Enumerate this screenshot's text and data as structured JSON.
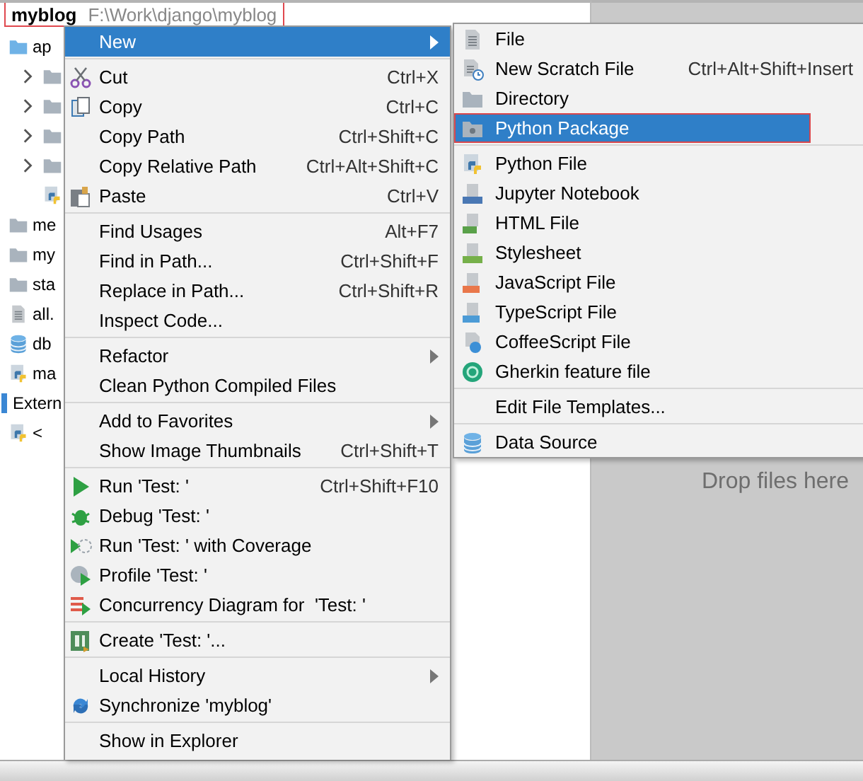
{
  "project_tree": {
    "root": {
      "label": "myblog",
      "path": "F:\\Work\\django\\myblog",
      "annotated": true
    },
    "items": [
      {
        "label": "ap",
        "kind": "folder",
        "children": [
          {
            "kind": "folder",
            "expanded": false
          },
          {
            "kind": "folder",
            "expanded": false
          },
          {
            "kind": "folder",
            "expanded": false
          },
          {
            "kind": "folder",
            "expanded": false
          },
          {
            "kind": "python"
          }
        ]
      },
      {
        "label": "me",
        "kind": "folder"
      },
      {
        "label": "my",
        "kind": "folder"
      },
      {
        "label": "sta",
        "kind": "folder"
      },
      {
        "label": "all.",
        "kind": "text"
      },
      {
        "label": "db",
        "kind": "database"
      },
      {
        "label": "ma",
        "kind": "python"
      }
    ],
    "external": {
      "label": "Extern",
      "children": [
        {
          "label": "<",
          "kind": "python"
        }
      ]
    }
  },
  "context_menu": {
    "groups": [
      [
        {
          "label": "New",
          "selected": true,
          "submenu": true
        }
      ],
      [
        {
          "label": "Cut",
          "shortcut": "Ctrl+X",
          "kind": "scissors",
          "selected": false
        },
        {
          "label": "Copy",
          "shortcut": "Ctrl+C",
          "kind": "copy",
          "selected": false
        },
        {
          "label": "Copy Path",
          "shortcut": "Ctrl+Shift+C",
          "selected": false
        },
        {
          "label": "Copy Relative Path",
          "shortcut": "Ctrl+Alt+Shift+C",
          "selected": false
        },
        {
          "label": "Paste",
          "shortcut": "Ctrl+V",
          "kind": "paste",
          "selected": false
        }
      ],
      [
        {
          "label": "Find Usages",
          "shortcut": "Alt+F7",
          "selected": false
        },
        {
          "label": "Find in Path...",
          "shortcut": "Ctrl+Shift+F",
          "selected": false
        },
        {
          "label": "Replace in Path...",
          "shortcut": "Ctrl+Shift+R",
          "selected": false
        },
        {
          "label": "Inspect Code...",
          "selected": false
        }
      ],
      [
        {
          "label": "Refactor",
          "submenu": true,
          "selected": false
        },
        {
          "label": "Clean Python Compiled Files",
          "selected": false
        }
      ],
      [
        {
          "label": "Add to Favorites",
          "submenu": true,
          "selected": false
        },
        {
          "label": "Show Image Thumbnails",
          "shortcut": "Ctrl+Shift+T",
          "selected": false
        }
      ],
      [
        {
          "label": "Run 'Test: '",
          "shortcut": "Ctrl+Shift+F10",
          "kind": "run",
          "selected": false
        },
        {
          "label": "Debug 'Test: '",
          "kind": "debug",
          "selected": false
        },
        {
          "label": "Run 'Test: ' with Coverage",
          "kind": "coverage",
          "selected": false
        },
        {
          "label": "Profile 'Test: '",
          "kind": "profile",
          "selected": false
        },
        {
          "label": "Concurrency Diagram for  'Test: '",
          "kind": "concurrency",
          "selected": false
        }
      ],
      [
        {
          "label": "Create 'Test: '...",
          "kind": "create",
          "selected": false
        }
      ],
      [
        {
          "label": "Local History",
          "submenu": true,
          "selected": false
        },
        {
          "label": "Synchronize 'myblog'",
          "kind": "sync",
          "selected": false
        }
      ],
      [
        {
          "label": "Show in Explorer",
          "selected": false
        }
      ]
    ]
  },
  "new_submenu": {
    "groups": [
      [
        {
          "label": "File",
          "kind": "file",
          "selected": false
        },
        {
          "label": "New Scratch File",
          "shortcut": "Ctrl+Alt+Shift+Insert",
          "kind": "scratch",
          "selected": false
        },
        {
          "label": "Directory",
          "kind": "folder",
          "selected": false
        },
        {
          "label": "Python Package",
          "kind": "package",
          "selected": true,
          "annotated": true
        }
      ],
      [
        {
          "label": "Python File",
          "kind": "python",
          "selected": false
        },
        {
          "label": "Jupyter Notebook",
          "kind": "jupyter",
          "selected": false
        },
        {
          "label": "HTML File",
          "kind": "html",
          "selected": false
        },
        {
          "label": "Stylesheet",
          "kind": "css",
          "selected": false
        },
        {
          "label": "JavaScript File",
          "kind": "js",
          "selected": false
        },
        {
          "label": "TypeScript File",
          "kind": "ts",
          "selected": false
        },
        {
          "label": "CoffeeScript File",
          "kind": "coffee",
          "selected": false
        },
        {
          "label": "Gherkin feature file",
          "kind": "gherkin",
          "selected": false
        }
      ],
      [
        {
          "label": "Edit File Templates...",
          "selected": false
        }
      ],
      [
        {
          "label": "Data Source",
          "kind": "database",
          "selected": false
        }
      ]
    ]
  },
  "editor": {
    "hint": "Drop files here"
  }
}
